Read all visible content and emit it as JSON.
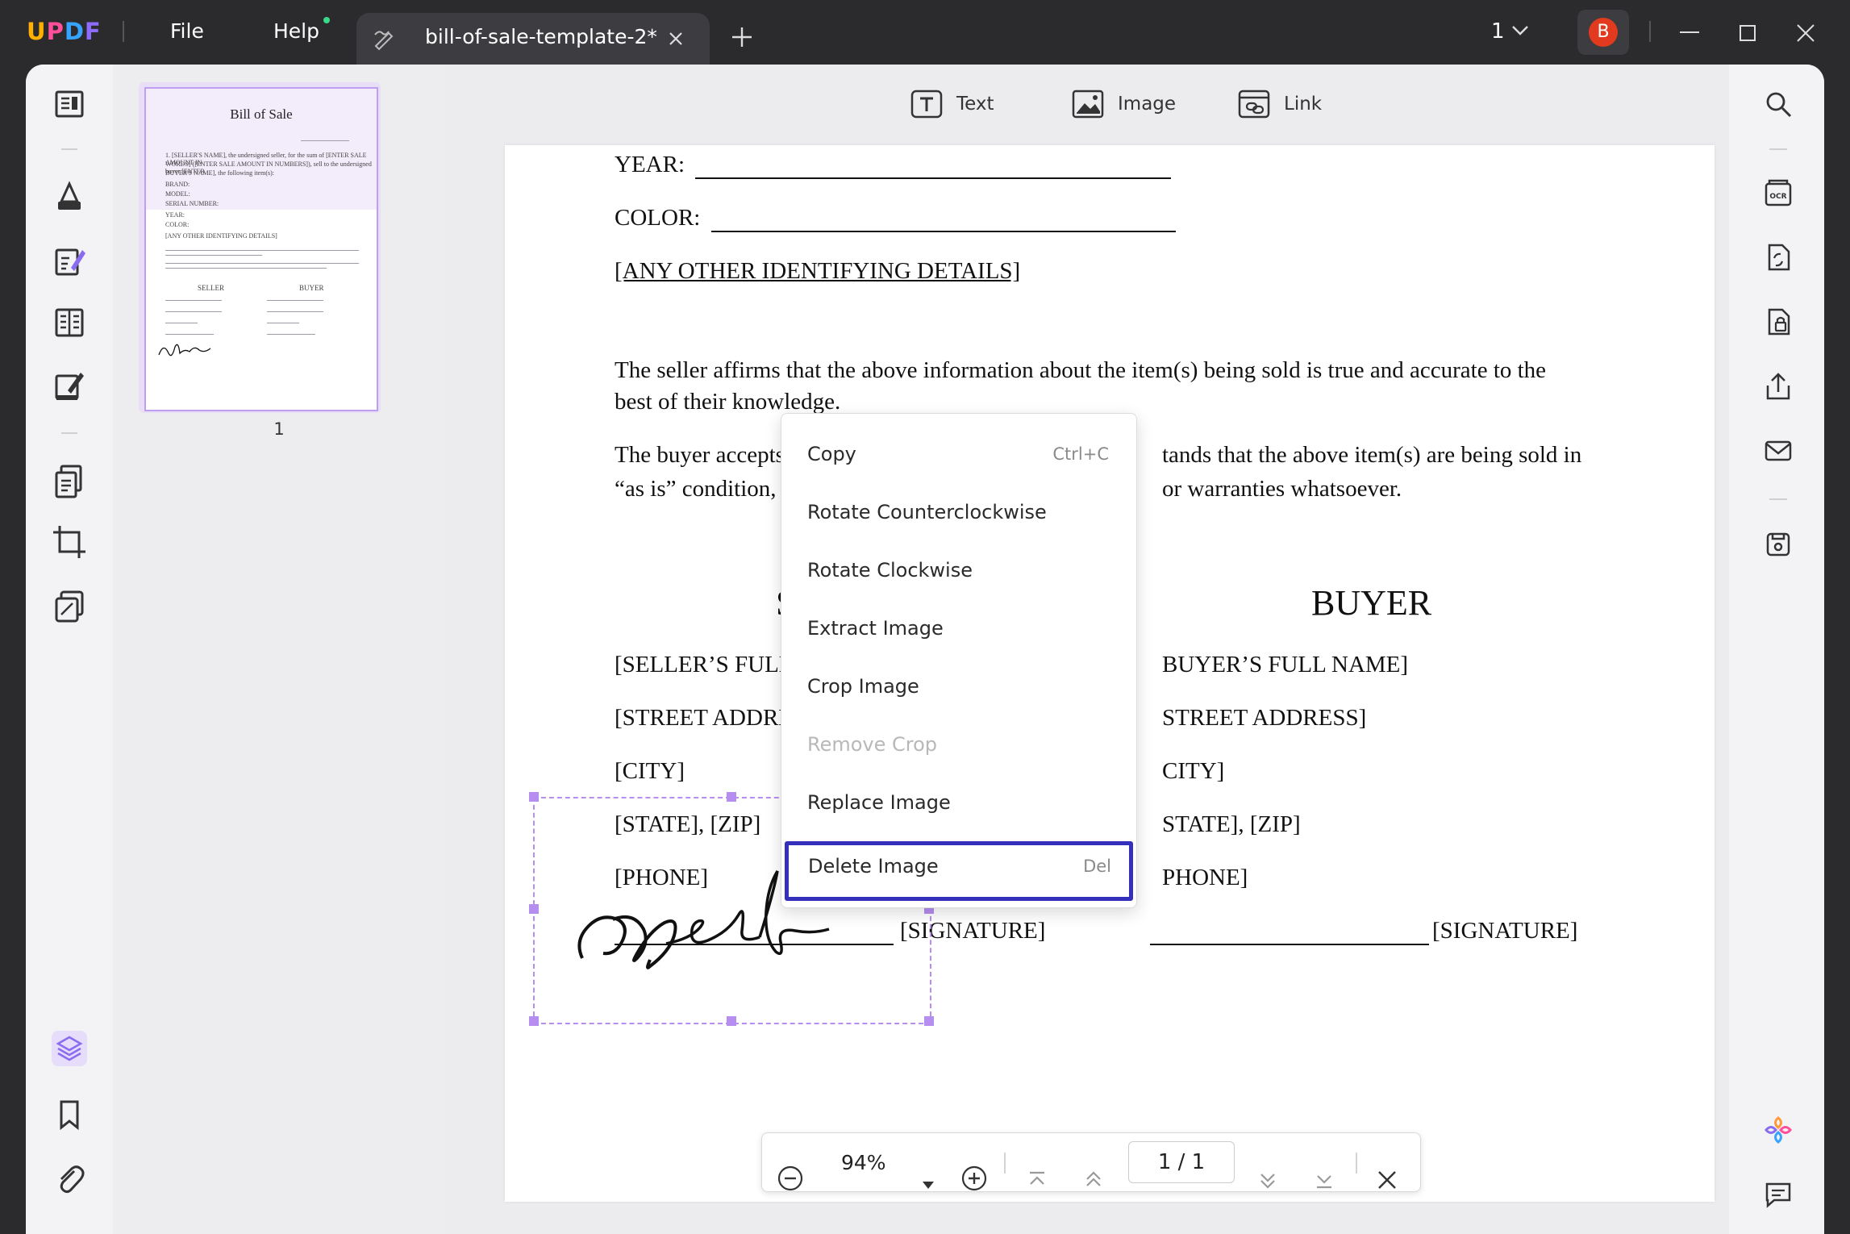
{
  "app": {
    "logo": "UPDF"
  },
  "menu": {
    "file": "File",
    "help": "Help"
  },
  "tab": {
    "title": "bill-of-sale-template-2*"
  },
  "titlebar": {
    "page_indicator": "1",
    "avatar_letter": "B"
  },
  "toolbar": {
    "text": "Text",
    "image": "Image",
    "link": "Link"
  },
  "thumbnail": {
    "title": "Bill of Sale",
    "page_number": "1",
    "lines": [
      "1. [SELLER'S NAME], the undersigned seller, for the sum of [ENTER SALE AMOUNT IN",
      "WORDS] ([ENTER SALE AMOUNT IN NUMBERS]), sell to the undersigned buyer [ENTER",
      "BUYER'S NAME], the following item(s):",
      "BRAND:",
      "MODEL:",
      "SERIAL NUMBER:",
      "YEAR:",
      "COLOR:",
      "[ANY OTHER IDENTIFYING DETAILS]"
    ],
    "seller": "SELLER",
    "buyer": "BUYER"
  },
  "document": {
    "year_label": "YEAR:",
    "color_label": "COLOR:",
    "details": "[ANY OTHER IDENTIFYING DETAILS]",
    "para1_line1": "The seller affirms that the above information about the item(s) being sold is true and accurate to the",
    "para1_line2": "best of their knowledge.",
    "para2_line1_left": "The buyer accepts r",
    "para2_line1_right": "tands that the above item(s) are being sold in",
    "para2_line2_left": "“as is” condition, ar",
    "para2_line2_right": "or warranties whatsoever.",
    "seller_heading": "SE",
    "buyer_heading": "BUYER",
    "seller_fields": [
      "[SELLER’S FULL",
      "[STREET ADDRES",
      "[CITY]",
      "[STATE], [ZIP]",
      "[PHONE]"
    ],
    "buyer_fields": [
      "BUYER’S FULL NAME]",
      "STREET ADDRESS]",
      "CITY]",
      "STATE], [ZIP]",
      "PHONE]"
    ],
    "signature_label": "[SIGNATURE]"
  },
  "context_menu": {
    "items": [
      {
        "label": "Copy",
        "shortcut": "Ctrl+C",
        "enabled": true
      },
      {
        "label": "Rotate Counterclockwise",
        "shortcut": "",
        "enabled": true
      },
      {
        "label": "Rotate Clockwise",
        "shortcut": "",
        "enabled": true
      },
      {
        "label": "Extract Image",
        "shortcut": "",
        "enabled": true
      },
      {
        "label": "Crop Image",
        "shortcut": "",
        "enabled": true
      },
      {
        "label": "Remove Crop",
        "shortcut": "",
        "enabled": false
      },
      {
        "label": "Replace Image",
        "shortcut": "",
        "enabled": true
      },
      {
        "label": "Delete Image",
        "shortcut": "Del",
        "enabled": true,
        "highlighted": true
      }
    ]
  },
  "bottom_nav": {
    "zoom": "94%",
    "page_display": "1 / 1"
  },
  "icons": {
    "left_sidebar": [
      "reader-icon",
      "highlight-icon",
      "edit-pdf-icon",
      "organize-icon",
      "fill-sign-icon",
      "page-tools-icon",
      "crop-icon",
      "compare-icon",
      "layers-icon",
      "bookmark-icon",
      "attachment-icon"
    ],
    "right_sidebar": [
      "search-icon",
      "ocr-icon",
      "convert-icon",
      "protect-icon",
      "share-icon",
      "email-icon",
      "save-icon",
      "ai-assistant-icon",
      "comment-icon"
    ]
  },
  "colors": {
    "accent": "#3430bb",
    "selection": "#b58ef0",
    "avatar": "#e23a1f"
  }
}
